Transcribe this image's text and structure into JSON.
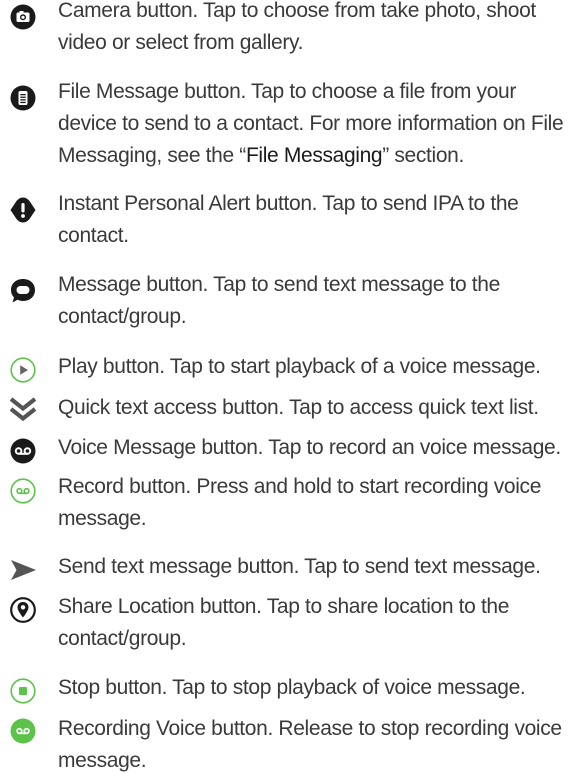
{
  "colors": {
    "text": "#3a3a3a",
    "icon_dark": "#1a1a1a",
    "icon_green": "#5cc24a",
    "icon_gray": "#666666"
  },
  "items": [
    {
      "icon": "camera-icon",
      "text": "Camera button. Tap to choose from take photo, shoot video or select from gallery."
    },
    {
      "icon": "file-icon",
      "text_before": "File Message button. Tap to choose a file from your device to send to a contact. For more information on File Messaging, see the “",
      "link": "File Messaging",
      "text_after": "” section."
    },
    {
      "icon": "alert-icon",
      "text": "Instant Personal Alert button. Tap to send IPA to the contact."
    },
    {
      "icon": "message-bubble-icon",
      "text": "Message button. Tap to send text message to the contact/group."
    },
    {
      "icon": "play-icon",
      "text": "Play button. Tap to start playback of a voice message."
    },
    {
      "icon": "double-chevron-down-icon",
      "text": "Quick text access button. Tap to access quick text list."
    },
    {
      "icon": "voicemail-icon",
      "text": "Voice Message button. Tap to record an voice message."
    },
    {
      "icon": "record-icon",
      "text": "Record button. Press and hold to start recording voice message."
    },
    {
      "icon": "send-arrow-icon",
      "text": "Send text message button. Tap to send text message."
    },
    {
      "icon": "location-pin-icon",
      "text": "Share Location button. Tap to share location to the contact/group."
    },
    {
      "icon": "stop-icon",
      "text": "Stop button. Tap to stop playback of voice message."
    },
    {
      "icon": "recording-voice-icon",
      "text": "Recording Voice button. Release to stop recording voice message."
    }
  ]
}
